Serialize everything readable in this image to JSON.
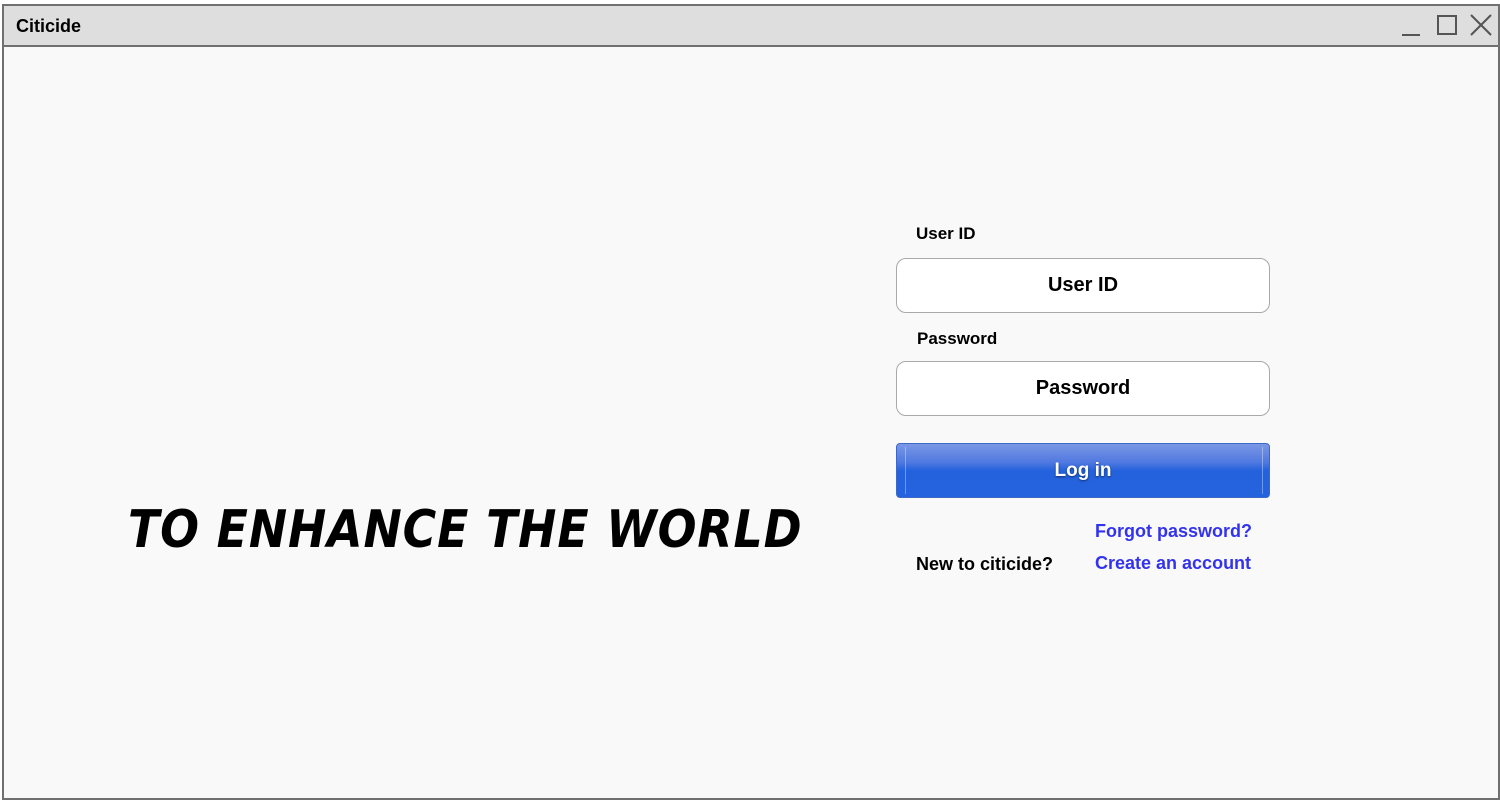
{
  "window": {
    "title": "Citicide"
  },
  "hero": {
    "slogan": "TO ENHANCE THE WORLD"
  },
  "login": {
    "user_id_label": "User ID",
    "user_id_placeholder": "User ID",
    "password_label": "Password",
    "password_placeholder": "Password",
    "login_button": "Log in",
    "forgot_password": "Forgot password?",
    "new_prompt": "New to citicide?",
    "create_account": "Create an account"
  },
  "colors": {
    "login_button": "#2563de",
    "link": "#3333ee",
    "titlebar": "#dedede",
    "background": "#f9f9f9"
  },
  "icons": {
    "minimize": "minimize-icon",
    "maximize": "maximize-icon",
    "close": "close-icon"
  }
}
